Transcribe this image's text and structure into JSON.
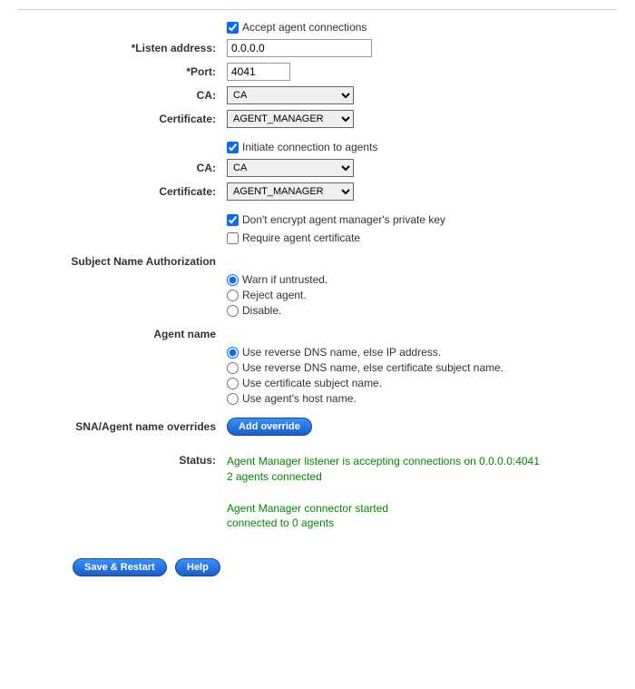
{
  "accept_connections": {
    "label": "Accept agent connections",
    "checked": true
  },
  "listen_address": {
    "label": "*Listen address:",
    "value": "0.0.0.0"
  },
  "port": {
    "label": "*Port:",
    "value": "4041"
  },
  "ca1": {
    "label": "CA:",
    "value": "CA"
  },
  "cert1": {
    "label": "Certificate:",
    "value": "AGENT_MANAGER"
  },
  "initiate": {
    "label": "Initiate connection to agents",
    "checked": true
  },
  "ca2": {
    "label": "CA:",
    "value": "CA"
  },
  "cert2": {
    "label": "Certificate:",
    "value": "AGENT_MANAGER"
  },
  "dont_encrypt": {
    "label": "Don't encrypt agent manager's private key",
    "checked": true
  },
  "require_cert": {
    "label": "Require agent certificate",
    "checked": false
  },
  "sna_heading": "Subject Name Authorization",
  "sna_options": {
    "warn": "Warn if untrusted.",
    "reject": "Reject agent.",
    "disable": "Disable."
  },
  "agent_name_heading": "Agent name",
  "agent_name_options": {
    "rdns_ip": "Use reverse DNS name, else IP address.",
    "rdns_cert": "Use reverse DNS name, else certificate subject name.",
    "cert": "Use certificate subject name.",
    "host": "Use agent's host name."
  },
  "overrides": {
    "label": "SNA/Agent name overrides",
    "button": "Add override"
  },
  "status": {
    "label": "Status:",
    "line1": "Agent Manager listener is accepting connections on 0.0.0.0:4041",
    "line2": "2 agents connected",
    "line3": "Agent Manager connector started",
    "line4": "connected to 0 agents"
  },
  "buttons": {
    "save": "Save & Restart",
    "help": "Help"
  }
}
